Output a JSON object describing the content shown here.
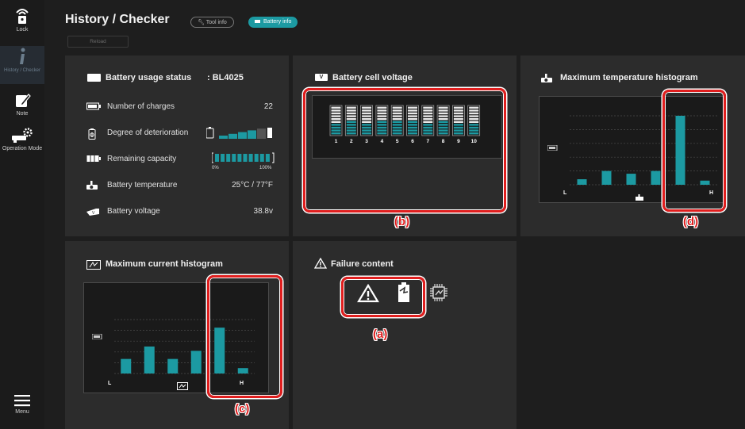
{
  "sidebar": {
    "items": [
      {
        "label": "Lock",
        "icon": "lock-icon"
      },
      {
        "label": "History / Checker",
        "icon": "info-icon",
        "active": true
      },
      {
        "label": "Note",
        "icon": "note-icon"
      },
      {
        "label": "Operation Mode",
        "icon": "operation-mode-icon"
      },
      {
        "label": "Menu",
        "icon": "hamburger-icon"
      }
    ]
  },
  "header": {
    "title": "History / Checker",
    "tabs": [
      {
        "label": "Tool info",
        "active": false
      },
      {
        "label": "Battery info",
        "active": true
      }
    ],
    "reload_label": "Reload"
  },
  "usage": {
    "title": "Battery usage status",
    "model": ": BL4025",
    "rows": [
      {
        "label": "Number of charges",
        "value": "22",
        "icon": "charge-counter-icon"
      },
      {
        "label": "Degree of deterioration",
        "value": "",
        "icon": "deterioration-icon"
      },
      {
        "label": "Remaining capacity",
        "value": "",
        "icon": "capacity-icon"
      },
      {
        "label": "Battery temperature",
        "value": "25°C / 77°F",
        "icon": "thermometer-icon"
      },
      {
        "label": "Battery voltage",
        "value": "38.8v",
        "icon": "voltage-icon"
      }
    ],
    "deterioration_bars_filled": 4,
    "deterioration_bars_total": 5,
    "capacity_min_label": "0%",
    "capacity_max_label": "100%",
    "capacity_fraction": 1.0
  },
  "cell_voltage": {
    "title": "Battery cell voltage",
    "cells": [
      "1",
      "2",
      "3",
      "4",
      "5",
      "6",
      "7",
      "8",
      "9",
      "10"
    ],
    "levels": [
      0.4,
      0.45,
      0.4,
      0.5,
      0.45,
      0.45,
      0.4,
      0.45,
      0.4,
      0.35
    ]
  },
  "temp_hist": {
    "title": "Maximum temperature histogram",
    "low_label": "L",
    "high_label": "H",
    "values": [
      0.08,
      0.2,
      0.16,
      0.2,
      1.0,
      0.06
    ]
  },
  "current_hist": {
    "title": "Maximum current histogram",
    "low_label": "L",
    "high_label": "H",
    "values": [
      0.27,
      0.5,
      0.27,
      0.42,
      0.85,
      0.1
    ]
  },
  "failure": {
    "title": "Failure content",
    "icons": [
      "warning-icon",
      "battery-fault-icon",
      "chip-icon"
    ]
  },
  "callouts": {
    "a": "(a)",
    "b": "(b)",
    "c": "(c)",
    "d": "(d)"
  },
  "colors": {
    "accent": "#1c9aa2",
    "highlight": "#e01e1e",
    "panel": "#2c2c2c"
  }
}
